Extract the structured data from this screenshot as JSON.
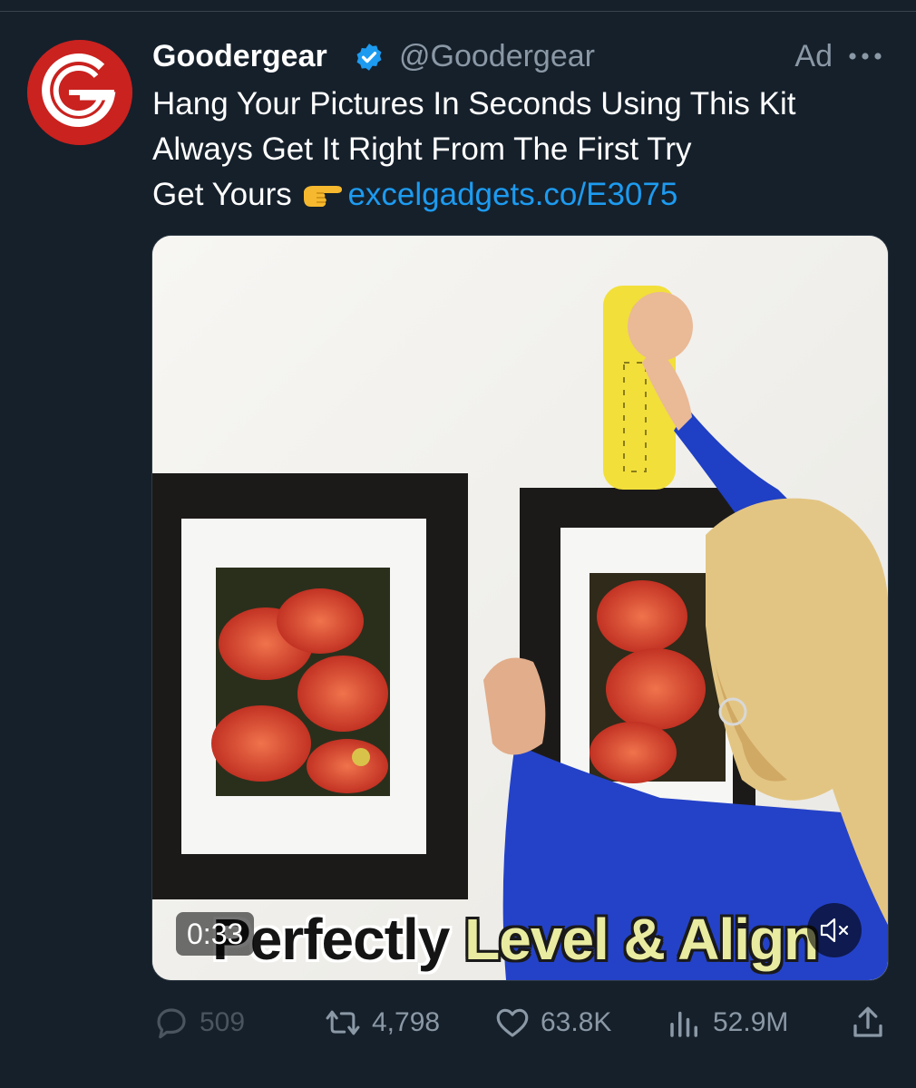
{
  "tweet": {
    "display_name": "Goodergear",
    "handle": "@Goodergear",
    "ad_label": "Ad",
    "lines": [
      "Hang Your Pictures  In Seconds Using This Kit",
      "Always Get It Right From The First Try",
      "Get Yours "
    ],
    "link_text": "excelgadgets.co/E3075"
  },
  "media": {
    "caption_first": "Perfectly ",
    "caption_highlight": "Level & Align",
    "duration": "0:33"
  },
  "actions": {
    "replies": "509",
    "retweets": "4,798",
    "likes": "63.8K",
    "views": "52.9M"
  },
  "icons": {
    "verified": "verified-badge-icon",
    "more": "more-icon",
    "reply": "reply-icon",
    "retweet": "retweet-icon",
    "like": "heart-icon",
    "views": "views-icon",
    "share": "share-icon",
    "mute": "mute-icon",
    "point": "pointing-hand-icon"
  },
  "colors": {
    "background": "#15202b",
    "link": "#1d9bf0",
    "secondary": "#8b98a5",
    "verified": "#1d9bf0",
    "brand": "#c9221f"
  }
}
